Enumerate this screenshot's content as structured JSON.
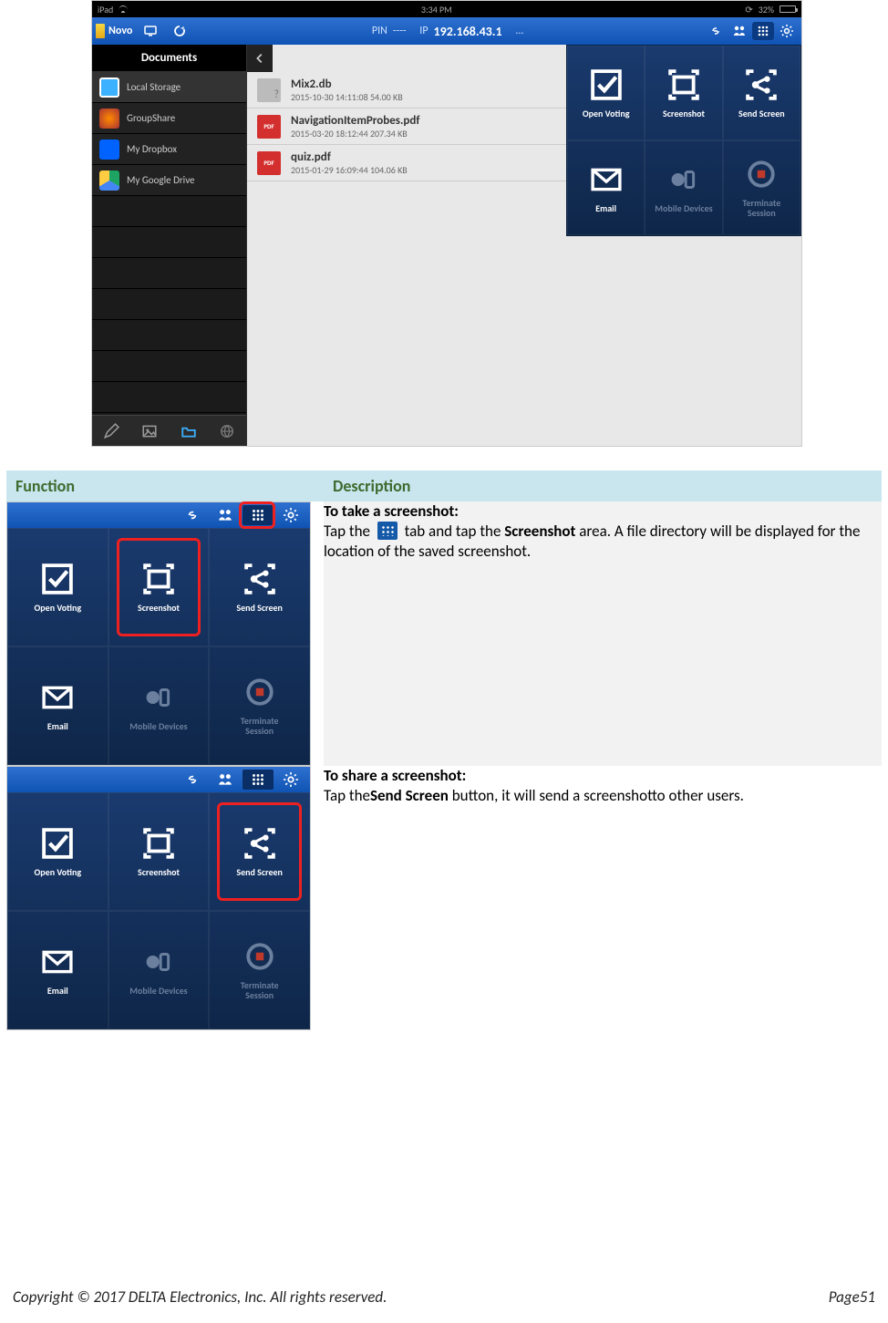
{
  "status": {
    "device": "iPad",
    "time": "3:34 PM",
    "battery": "32%"
  },
  "appbar": {
    "brand": "Novo",
    "pin_label": "PIN",
    "pin_value": "----",
    "ip_label": "IP",
    "ip_value": "192.168.43.1",
    "more": "..."
  },
  "sidebar": {
    "title": "Documents",
    "sources": [
      {
        "label": "Local Storage",
        "icon": "local"
      },
      {
        "label": "GroupShare",
        "icon": "group"
      },
      {
        "label": "My Dropbox",
        "icon": "dropbox"
      },
      {
        "label": "My Google Drive",
        "icon": "gdrive"
      }
    ]
  },
  "files": [
    {
      "name": "Mix2.db",
      "meta": "2015-10-30 14:11:08   54.00 KB",
      "type": "db"
    },
    {
      "name": "NavigationItemProbes.pdf",
      "meta": "2015-03-20 18:12:44   207.34 KB",
      "type": "pdf"
    },
    {
      "name": "quiz.pdf",
      "meta": "2015-01-29 16:09:44   104.06 KB",
      "type": "pdf"
    }
  ],
  "actions": {
    "open_voting": "Open Voting",
    "screenshot": "Screenshot",
    "send_screen": "Send Screen",
    "email": "Email",
    "mobile_devices": "Mobile Devices",
    "terminate": "Terminate\nSession"
  },
  "table": {
    "col1": "Function",
    "col2": "Description",
    "row1": {
      "title": "To take a screenshot:",
      "body_a": "Tap the ",
      "body_b": " tab and tap the ",
      "bold": "Screenshot",
      "body_c": " area. A file directory will be displayed for the location of the saved screenshot."
    },
    "row2": {
      "title": "To share a screenshot:",
      "body_a": "Tap the",
      "bold": "Send Screen",
      "body_b": " button, it will send a screenshotto other users."
    }
  },
  "footer": {
    "copyright": "Copyright © 2017 DELTA Electronics, Inc. All rights reserved.",
    "page": "Page51"
  }
}
